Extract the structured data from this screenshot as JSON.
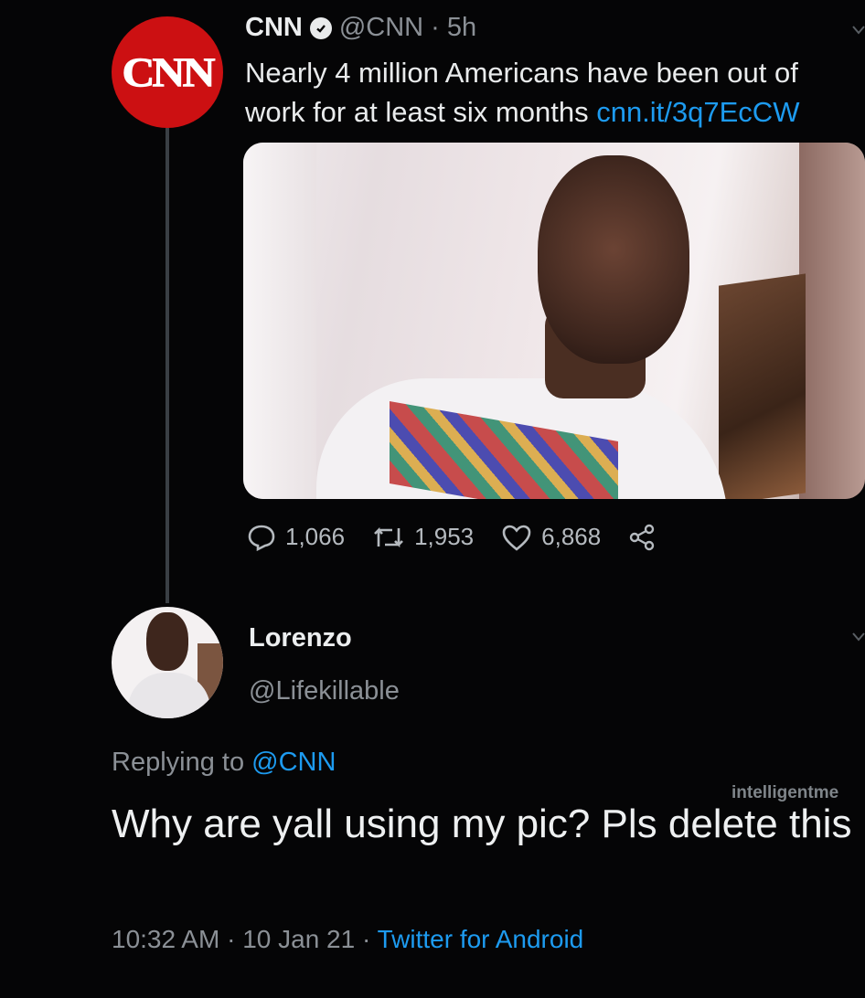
{
  "original_tweet": {
    "avatar_logo": "CNN",
    "display_name": "CNN",
    "handle": "@CNN",
    "time": "5h",
    "text": "Nearly 4 million Americans have been out of work for at least six months",
    "link": "cnn.it/3q7EcCW",
    "actions": {
      "replies": "1,066",
      "retweets": "1,953",
      "likes": "6,868"
    }
  },
  "reply_tweet": {
    "display_name": "Lorenzo",
    "handle": "@Lifekillable",
    "replying_prefix": "Replying to",
    "replying_to": "@CNN",
    "text": "Why are yall using my pic? Pls delete this",
    "time": "10:32 AM",
    "date": "10 Jan 21",
    "source": "Twitter for Android"
  },
  "watermark": "intelligentme",
  "colors": {
    "background": "#050506",
    "link": "#1d9bf0",
    "cnn_red": "#cc1012",
    "muted": "#8b9096"
  },
  "icons": [
    "verified-icon",
    "reply-icon",
    "retweet-icon",
    "like-icon",
    "share-icon",
    "chevron-down-icon"
  ]
}
